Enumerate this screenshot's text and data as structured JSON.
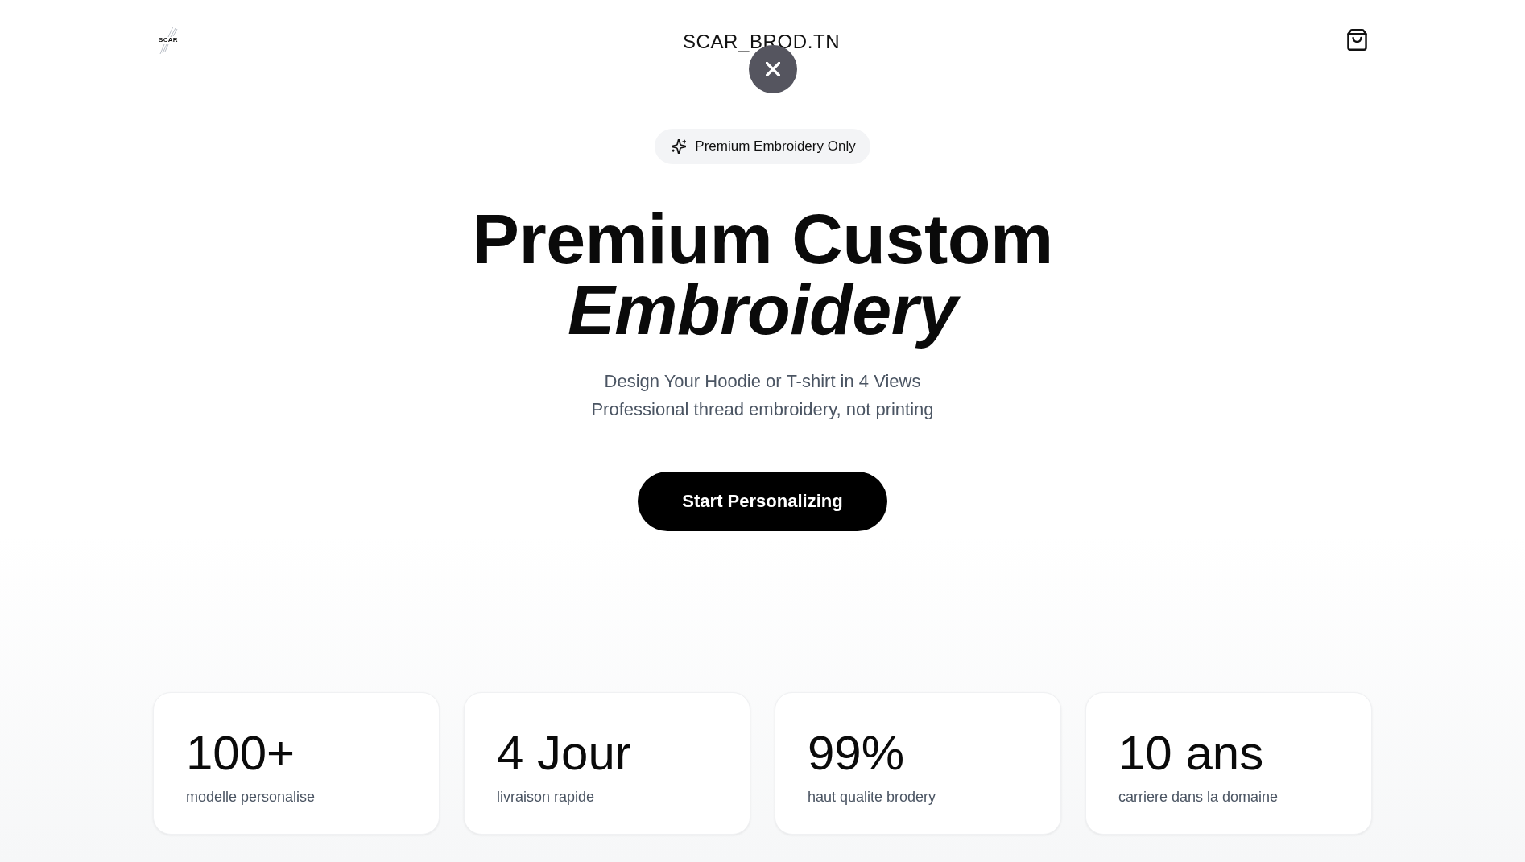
{
  "header": {
    "logo_text": "SCAR",
    "title": "SCAR_BROD.TN"
  },
  "hero": {
    "badge": "Premium Embroidery Only",
    "heading": "Premium Custom *Embroidery*",
    "subtitle_lines": [
      "Design Your Hoodie or T-shirt in 4 Views",
      "Professional thread embroidery, not printing"
    ],
    "cta": "Start Personalizing"
  },
  "stats": [
    {
      "value": "100+",
      "label": "modelle personalise"
    },
    {
      "value": "4 Jour",
      "label": "livraison rapide"
    },
    {
      "value": "99%",
      "label": "haut qualite brodery"
    },
    {
      "value": "10 ans",
      "label": "carriere dans la domaine"
    }
  ]
}
